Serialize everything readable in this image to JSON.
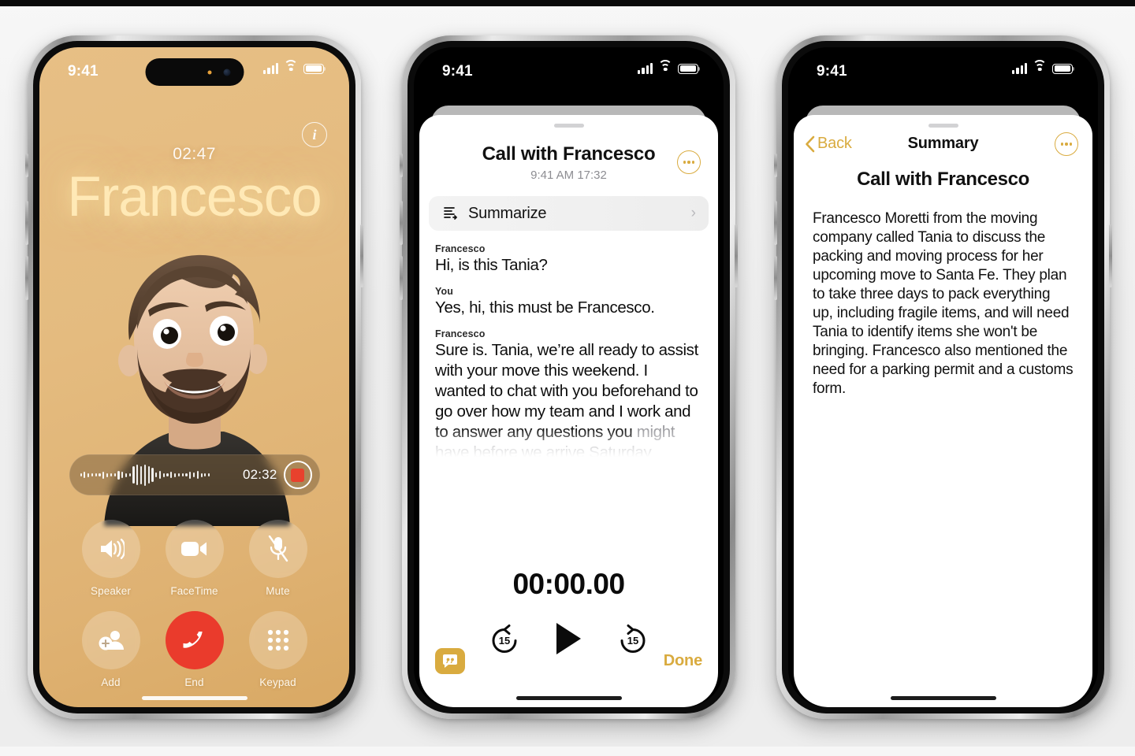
{
  "phone_call": {
    "status_bar": {
      "time": "9:41",
      "signal_icon": "cellular-bars-icon",
      "wifi_icon": "wifi-icon",
      "battery_icon": "battery-icon"
    },
    "info_icon": "info-icon",
    "call_timer": "02:47",
    "caller_name": "Francesco",
    "avatar": "memoji-avatar",
    "recording": {
      "waveform_icon": "audio-waveform",
      "elapsed": "02:32",
      "record_icon": "stop-recording-icon"
    },
    "controls": [
      {
        "label": "Speaker",
        "icon": "speaker-icon"
      },
      {
        "label": "FaceTime",
        "icon": "video-camera-icon"
      },
      {
        "label": "Mute",
        "icon": "microphone-muted-icon"
      },
      {
        "label": "Add",
        "icon": "add-person-icon"
      },
      {
        "label": "End",
        "icon": "end-call-icon"
      },
      {
        "label": "Keypad",
        "icon": "keypad-icon"
      }
    ]
  },
  "phone_transcript": {
    "status_bar": {
      "time": "9:41"
    },
    "title": "Call with Francesco",
    "subtitle": "9:41 AM  17:32",
    "more_icon": "more-options-icon",
    "summarize": {
      "label": "Summarize",
      "icon": "summarize-icon",
      "chevron": "chevron-right-icon"
    },
    "lines": [
      {
        "speaker": "Francesco",
        "text": "Hi, is this Tania?",
        "faded": false
      },
      {
        "speaker": "You",
        "text": "Yes, hi, this must be Francesco.",
        "faded": false
      },
      {
        "speaker": "Francesco",
        "text": "Sure is. Tania, we’re all ready to assist with your move this weekend. I wanted to chat with you beforehand to go over how my team and I work and to answer any questions you ",
        "faded_tail": "might have before we arrive Saturday"
      }
    ],
    "player": {
      "time": "00:00.00",
      "back_label": "15",
      "forward_label": "15",
      "back_icon": "skip-back-15-icon",
      "play_icon": "play-icon",
      "forward_icon": "skip-forward-15-icon"
    },
    "footer": {
      "transcript_icon": "live-transcript-icon",
      "done_label": "Done"
    }
  },
  "phone_summary": {
    "status_bar": {
      "time": "9:41"
    },
    "back_label": "Back",
    "back_icon": "chevron-left-icon",
    "nav_title": "Summary",
    "more_icon": "more-options-icon",
    "heading": "Call with Francesco",
    "body": "Francesco Moretti from the moving company called Tania to discuss the packing and moving process for her upcoming move to Santa Fe. They plan to take three days to pack everything up, including fragile items, and will need Tania to identify items she won't be bringing. Francesco also mentioned the need for a parking permit and a customs form."
  },
  "colors": {
    "call_background": "#e4bb7f",
    "caller_name": "#ffe9b6",
    "end_call_red": "#ea3b2c",
    "accent_gold": "#d9ab3f",
    "page_background": "#efefef"
  }
}
